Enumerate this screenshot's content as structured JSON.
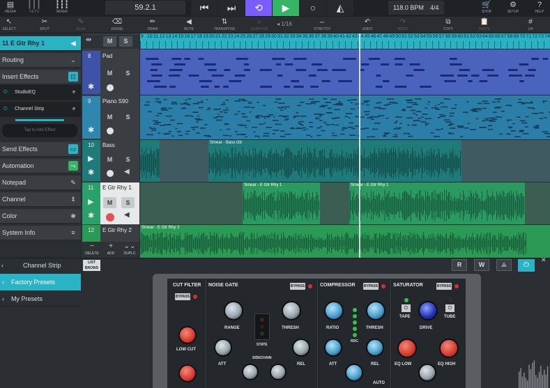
{
  "topbar": {
    "media_label": "MEDIA",
    "keys_label": "KEYS",
    "mixer_label": "MIXER",
    "position": "59.2.1",
    "tempo": "118.0 BPM",
    "signature": "4/4",
    "shop_label": "SHOP",
    "setup_label": "SETUP",
    "help_label": "HELP"
  },
  "toolbar": {
    "select": "SELECT",
    "split": "SPLIT",
    "glue": "GLUE",
    "erase": "ERASE",
    "draw": "DRAW",
    "mute": "MUTE",
    "transpose": "TRANSPOSE",
    "quantize": "QUANTIZE",
    "quantize_value": "1/16",
    "stretch": "STRETCH",
    "undo": "UNDO",
    "redo": "REDO",
    "copy": "COPY",
    "paste": "PASTE",
    "grid": "1/4"
  },
  "inspector": {
    "track_title": "11 E Gtr Rhy 1",
    "routing": "Routing",
    "insert_effects": "Insert Effects",
    "inserts": [
      "StudioEQ",
      "Channel Strip"
    ],
    "tap_to_add": "Tap to Add Effect",
    "send_effects": "Send Effects",
    "automation": "Automation",
    "notepad": "Notepad",
    "channel": "Channel",
    "color": "Color",
    "system_info": "System Info"
  },
  "ruler": {
    "bars": [
      "9",
      "10",
      "11",
      "12",
      "13",
      "14",
      "15",
      "16",
      "17",
      "18",
      "19",
      "20",
      "21",
      "22",
      "23",
      "24",
      "25",
      "26",
      "27",
      "28",
      "29",
      "30",
      "31",
      "32",
      "33",
      "34",
      "35",
      "36",
      "37",
      "38",
      "39",
      "40",
      "41",
      "42",
      "43",
      "44",
      "45",
      "46",
      "47",
      "48",
      "49",
      "50",
      "51",
      "52",
      "53",
      "54",
      "55",
      "56",
      "57",
      "58",
      "59",
      "60",
      "61",
      "62",
      "63",
      "64",
      "65",
      "66",
      "67",
      "68",
      "69",
      "70",
      "71",
      "72",
      "73",
      "74"
    ]
  },
  "tracks": [
    {
      "number": "8",
      "name": "Pad",
      "m": "M",
      "s": "S"
    },
    {
      "number": "9",
      "name": "Piano S90",
      "m": "M",
      "s": "S"
    },
    {
      "number": "10",
      "name": "Bass",
      "m": "M",
      "s": "S"
    },
    {
      "number": "11",
      "name": "E Gtr Rhy 1",
      "m": "M",
      "s": "S"
    },
    {
      "number": "12",
      "name": "E Gtr Rhy 2",
      "m": "M",
      "s": "S"
    }
  ],
  "clips": {
    "bass": "Smear - Bass Gtr",
    "gtr1_a": "Smear - E Gtr Rhy 1",
    "gtr1_b": "Smear - E Gtr Rhy 1",
    "gtr2": "Smear - E Gtr Rhy 2"
  },
  "track_actions": {
    "delete": "DELETE",
    "add": "ADD",
    "duplicate": "DUPLC"
  },
  "bottom": {
    "panel_title": "Channel Strip",
    "list_browse": "LIST BROWS",
    "factory_presets": "Factory Presets",
    "my_presets": "My Presets",
    "r": "R",
    "w": "W"
  },
  "plugin": {
    "cut_filter": "CUT FILTER",
    "noise_gate": "NOISE GATE",
    "compressor": "COMPRESSOR",
    "saturator": "SATURATOR",
    "bypass": "BYPASS",
    "low_cut": "LOW CUT",
    "range": "RANGE",
    "thresh": "THRESH",
    "state": "STATE",
    "att": "ATT",
    "rel": "REL",
    "sidechain": "SIDECHAIN",
    "ratio": "RATIO",
    "rdc": "RDC",
    "comp_thresh": "THRESH",
    "comp_att": "ATT",
    "comp_rel": "REL",
    "auto": "AUTO",
    "tape": "TAPE",
    "drive": "DRIVE",
    "tube": "TUBE",
    "eq_low": "EQ LOW",
    "eq_high": "EQ HIGH"
  },
  "colors": {
    "accent_cyan": "#2ab3c4",
    "accent_green": "#36b565",
    "transport_purple": "#7b5cff",
    "pad_blue": "#3e52a8",
    "bass_teal": "#1f7a7a",
    "gtr_green": "#2a9a55"
  }
}
